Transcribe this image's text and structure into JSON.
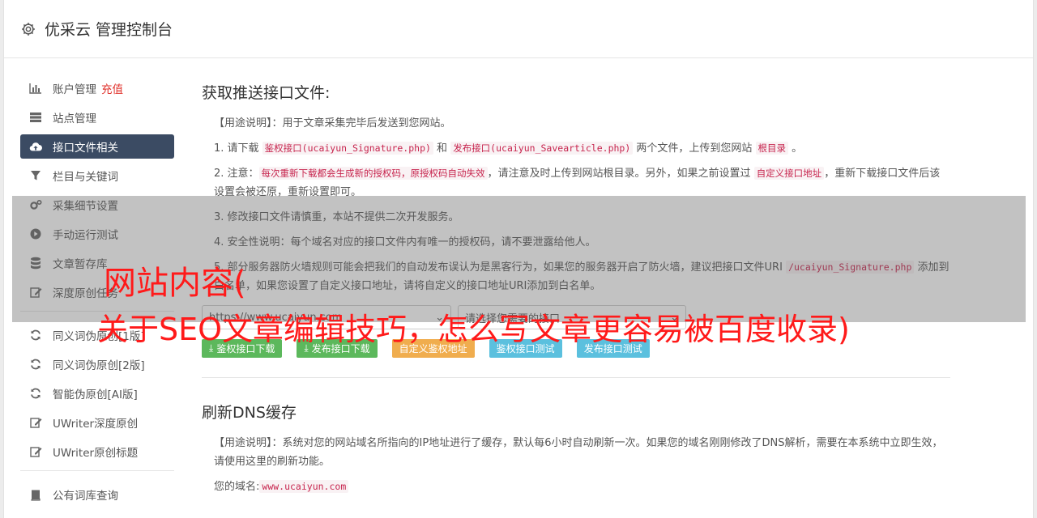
{
  "header": {
    "title": "优采云 管理控制台",
    "icon": "gear-icon"
  },
  "sidebar": {
    "groups": [
      [
        {
          "label": "账户管理",
          "extra": "充值",
          "icon": "bar-chart-icon"
        },
        {
          "label": "站点管理",
          "icon": "server-icon"
        },
        {
          "label": "接口文件相关",
          "icon": "cloud-upload-icon",
          "active": true
        },
        {
          "label": "栏目与关键词",
          "icon": "filter-icon"
        },
        {
          "label": "采集细节设置",
          "icon": "cogs-icon"
        },
        {
          "label": "手动运行测试",
          "icon": "play-circle-icon"
        },
        {
          "label": "文章暂存库",
          "icon": "database-icon"
        },
        {
          "label": "深度原创任务",
          "icon": "edit-icon"
        }
      ],
      [
        {
          "label": "同义词伪原创[1版]",
          "icon": "refresh-icon"
        },
        {
          "label": "同义词伪原创[2版]",
          "icon": "refresh-icon"
        },
        {
          "label": "智能伪原创[AI版]",
          "icon": "refresh-icon"
        },
        {
          "label": "UWriter深度原创",
          "icon": "edit-icon"
        },
        {
          "label": "UWriter原创标题",
          "icon": "edit-icon"
        }
      ],
      [
        {
          "label": "公有词库查询",
          "icon": "book-icon"
        }
      ]
    ]
  },
  "section1": {
    "title": "获取推送接口文件:",
    "usage_tag": "【用途说明】",
    "usage_text": "：用于文章采集完毕后发送到您网站。",
    "step1": {
      "pre": "1. 请下载 ",
      "code1": "鉴权接口(ucaiyun_Signature.php)",
      "mid": " 和 ",
      "code2": "发布接口(ucaiyun_Savearticle.php)",
      "post": " 两个文件，上传到您网站 ",
      "code3": "根目录",
      "end": " 。"
    },
    "step2": {
      "pre": "2. 注意：",
      "code1": "每次重新下载都会生成新的授权码，原授权码自动失效",
      "mid": "，请注意及时上传到网站根目录。另外，如果之前设置过 ",
      "code2": "自定义接口地址",
      "post": "，重新下载接口文件后该设置会被还原，重新设置即可。"
    },
    "step3": "3. 修改接口文件请慎重，本站不提供二次开发服务。",
    "step4": "4. 安全性说明：每个域名对应的接口文件内有唯一的授权码，请不要泄露给他人。",
    "step5": {
      "pre": "5. 部分服务器防火墙规则可能会把我们的自动发布误认为是黑客行为，如果您的服务器开启了防火墙，建议把接口文件URI ",
      "code1": "/ucaiyun_Signature.php",
      "post": " 添加到白名单，如果您设置了自定义接口地址，请将自定义的接口地址URI添加到白名单。"
    },
    "url_input": "https://www.ucaiyun.com",
    "select_value": "请选择您需要的接口",
    "buttons": {
      "download_auth": "鉴权接口下载",
      "download_publish": "发布接口下载",
      "custom_auth_url": "自定义鉴权地址",
      "test_auth": "鉴权接口测试",
      "test_publish": "发布接口测试"
    }
  },
  "section2": {
    "title": "刷新DNS缓存",
    "usage_tag": "【用途说明】",
    "usage_text": "：系统对您的网站域名所指向的IP地址进行了缓存，默认每6小时自动刷新一次。如果您的域名刚刚修改了DNS解析，需要在本系统中立即生效，请使用这里的刷新功能。",
    "domain_label": "您的域名:",
    "domain_value": "www.ucaiyun.com"
  },
  "overlay": {
    "line1": "网站内容(",
    "line2": "关于SEO文章编辑技巧，怎么写文章更容易被百度收录)"
  }
}
